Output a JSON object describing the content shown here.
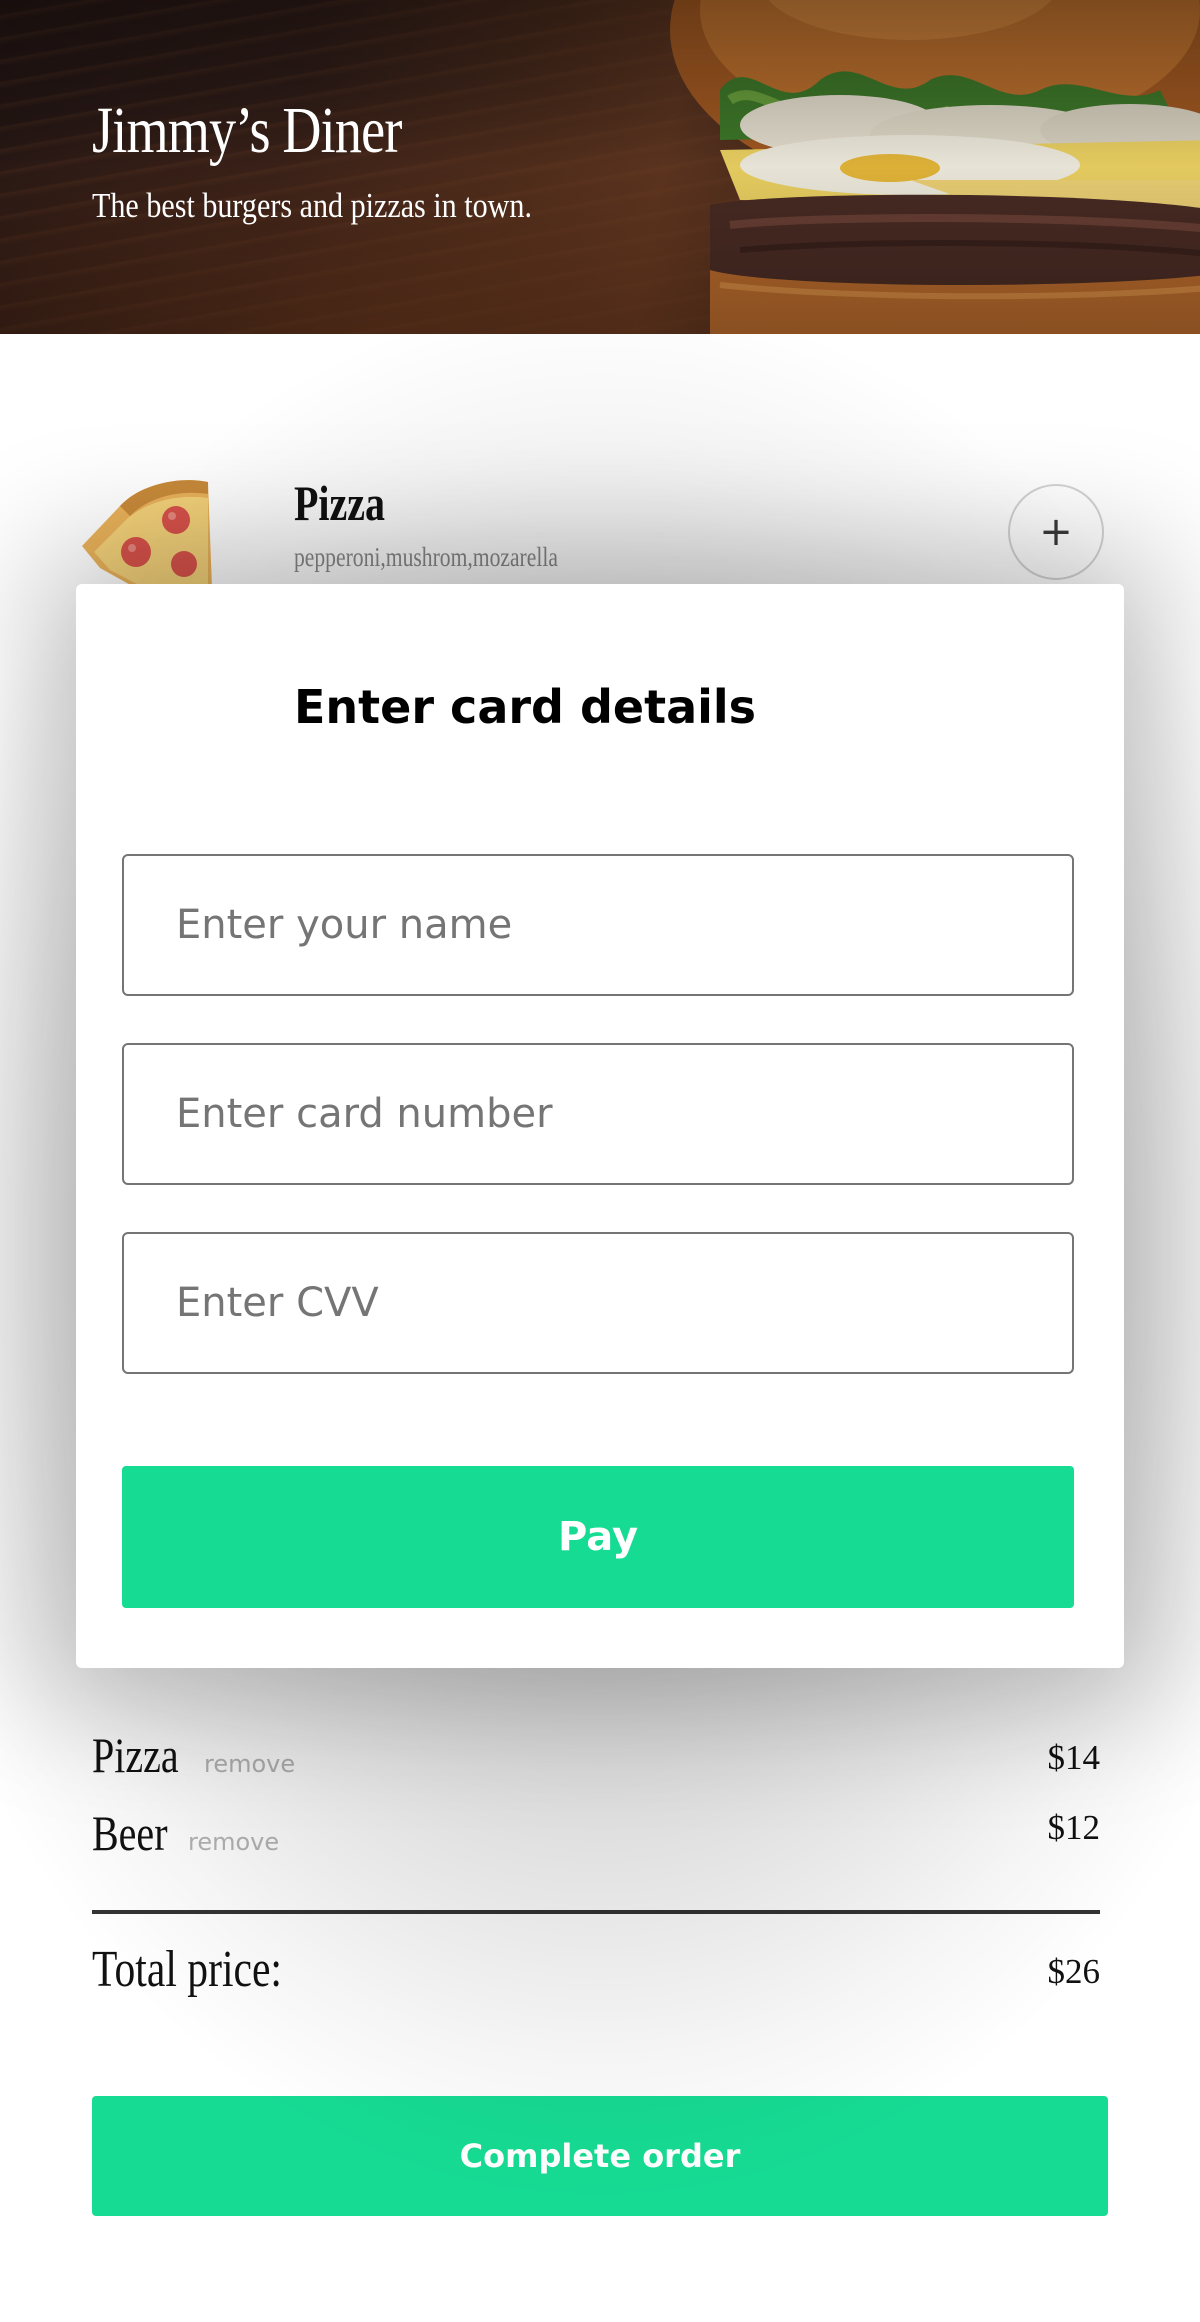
{
  "header": {
    "title": "Jimmy’s Diner",
    "subtitle": "The best burgers and pizzas in town."
  },
  "menu": {
    "items": [
      {
        "icon": "pizza-icon",
        "name": "Pizza",
        "description": "pepperoni,mushrom,mozarella",
        "add_label": "+"
      }
    ]
  },
  "modal": {
    "title": "Enter card details",
    "fields": {
      "name_placeholder": "Enter your name",
      "card_number_placeholder": "Enter card number",
      "cvv_placeholder": "Enter CVV"
    },
    "pay_label": "Pay"
  },
  "order": {
    "items": [
      {
        "name": "Pizza",
        "remove_label": "remove",
        "price": "$14"
      },
      {
        "name": "Beer",
        "remove_label": "remove",
        "price": "$12"
      }
    ],
    "total_label": "Total price:",
    "total_value": "$26",
    "complete_label": "Complete order"
  },
  "colors": {
    "accent": "#16db93",
    "text": "#111111",
    "muted": "#8a8a8a",
    "remove": "#b4b4b4"
  }
}
